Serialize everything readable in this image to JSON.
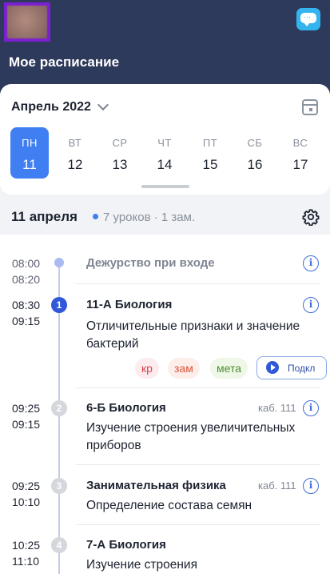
{
  "header": {
    "title": "Мое расписание",
    "chat_icon": "chat-bubble-icon"
  },
  "calendar": {
    "month": "Апрель 2022",
    "days": [
      {
        "name": "ПН",
        "date": "11",
        "active": true
      },
      {
        "name": "ВТ",
        "date": "12"
      },
      {
        "name": "СР",
        "date": "13"
      },
      {
        "name": "ЧТ",
        "date": "14"
      },
      {
        "name": "ПТ",
        "date": "15"
      },
      {
        "name": "СБ",
        "date": "16"
      },
      {
        "name": "ВС",
        "date": "17"
      }
    ]
  },
  "day_summary": {
    "date": "11 апреля",
    "summary": "7 уроков · 1 зам."
  },
  "lessons": [
    {
      "start": "08:00",
      "end": "08:20",
      "title": "Дежурство при входе"
    },
    {
      "num": "1",
      "start": "08:30",
      "end": "09:15",
      "title": "11-А Биология",
      "topic": "Отличительные признаки и значение бактерий",
      "tags": [
        "кр",
        "зам",
        "мета"
      ],
      "connect_label": "Подкл"
    },
    {
      "num": "2",
      "start": "09:25",
      "end": "09:15",
      "title": "6-Б Биология",
      "room": "каб. 111",
      "topic": "Изучение строения увеличительных приборов"
    },
    {
      "num": "3",
      "start": "09:25",
      "end": "10:10",
      "title": "Занимательная физика",
      "room": "каб. 111",
      "topic": "Определение состава семян"
    },
    {
      "num": "4",
      "start": "10:25",
      "end": "11:10",
      "title": "7-А Биология",
      "topic": "Изучение строения"
    }
  ],
  "colors": {
    "header_bg": "#2e3a5b",
    "accent": "#3f7ff2",
    "avatar_frame": "#7b1fd1"
  }
}
